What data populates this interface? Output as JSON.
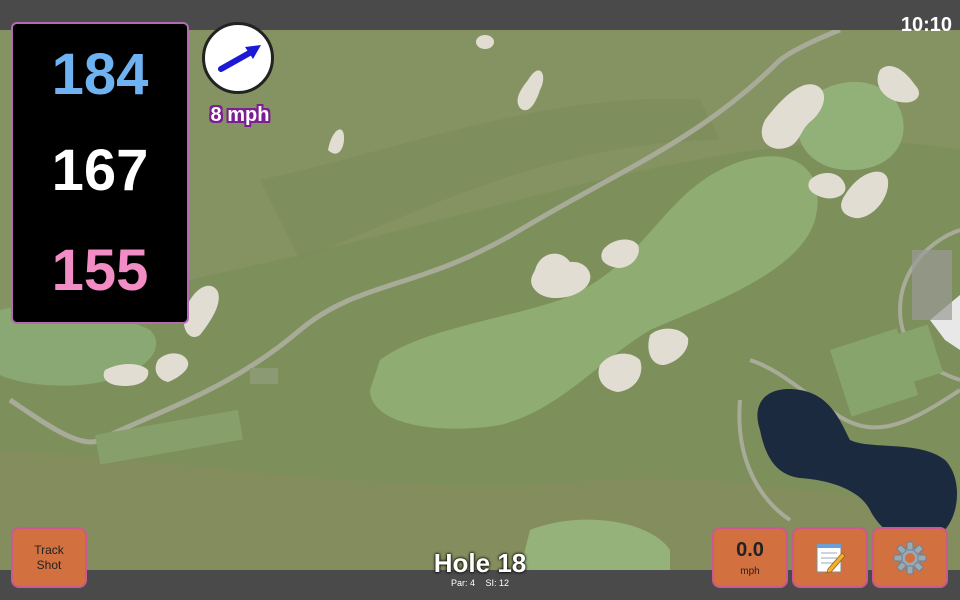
{
  "status": {
    "clock": "10:10"
  },
  "yardages": {
    "back": "184",
    "middle": "167",
    "front": "155",
    "colors": {
      "back": "#6fb2f2",
      "middle": "#ffffff",
      "front": "#f28cc4"
    }
  },
  "wind": {
    "speed": "8 mph",
    "direction_icon": "wind-arrow-icon",
    "arrow_color": "#1a1ad6"
  },
  "buttons": {
    "track_shot": {
      "line1": "Track",
      "line2": "Shot"
    },
    "speed": {
      "value": "0.0",
      "unit": "mph"
    },
    "notes_icon": "notepad-icon",
    "settings_icon": "gear-icon"
  },
  "hole": {
    "title": "Hole 18",
    "par": "Par: 4",
    "si": "SI: 12"
  },
  "colors": {
    "button": "#d2703f",
    "button_border": "#c95a8f",
    "panel_border": "#b46bb4",
    "bar": "#4a4a4a"
  }
}
